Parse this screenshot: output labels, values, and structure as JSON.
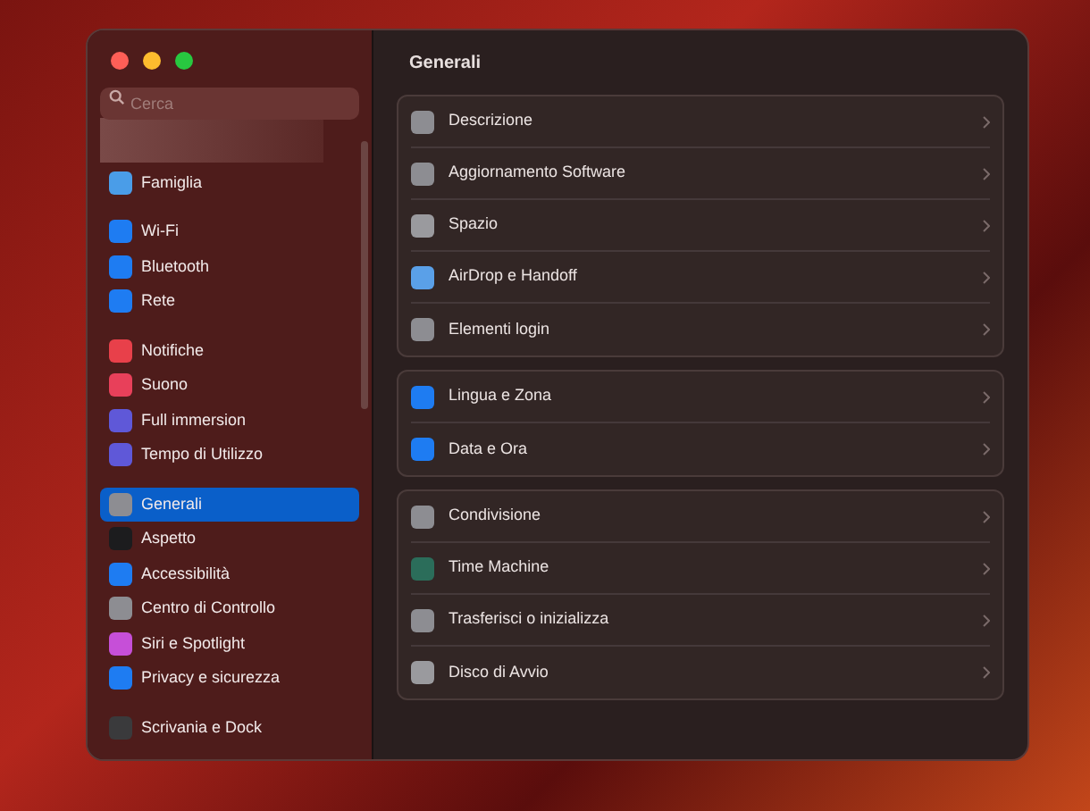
{
  "search": {
    "placeholder": "Cerca"
  },
  "sidebar": {
    "groups": [
      {
        "items": [
          {
            "label": "Famiglia",
            "selected": false
          }
        ]
      },
      {
        "items": [
          {
            "label": "Wi-Fi",
            "selected": false
          },
          {
            "label": "Bluetooth",
            "selected": false
          },
          {
            "label": "Rete",
            "selected": false
          }
        ]
      },
      {
        "items": [
          {
            "label": "Notifiche",
            "selected": false
          },
          {
            "label": "Suono",
            "selected": false
          },
          {
            "label": "Full immersion",
            "selected": false
          },
          {
            "label": "Tempo di Utilizzo",
            "selected": false
          }
        ]
      },
      {
        "items": [
          {
            "label": "Generali",
            "selected": true
          },
          {
            "label": "Aspetto",
            "selected": false
          },
          {
            "label": "Accessibilità",
            "selected": false
          },
          {
            "label": "Centro di Controllo",
            "selected": false
          },
          {
            "label": "Siri e Spotlight",
            "selected": false
          },
          {
            "label": "Privacy e sicurezza",
            "selected": false
          }
        ]
      },
      {
        "items": [
          {
            "label": "Scrivania e Dock",
            "selected": false
          }
        ]
      }
    ]
  },
  "main": {
    "title": "Generali",
    "groups": [
      {
        "rows": [
          {
            "label": "Descrizione"
          },
          {
            "label": "Aggiornamento Software"
          },
          {
            "label": "Spazio"
          },
          {
            "label": "AirDrop e Handoff"
          },
          {
            "label": "Elementi login"
          }
        ]
      },
      {
        "rows": [
          {
            "label": "Lingua e Zona"
          },
          {
            "label": "Data e Ora"
          }
        ]
      },
      {
        "rows": [
          {
            "label": "Condivisione"
          },
          {
            "label": "Time Machine"
          },
          {
            "label": "Trasferisci o inizializza"
          },
          {
            "label": "Disco di Avvio"
          }
        ]
      }
    ]
  }
}
